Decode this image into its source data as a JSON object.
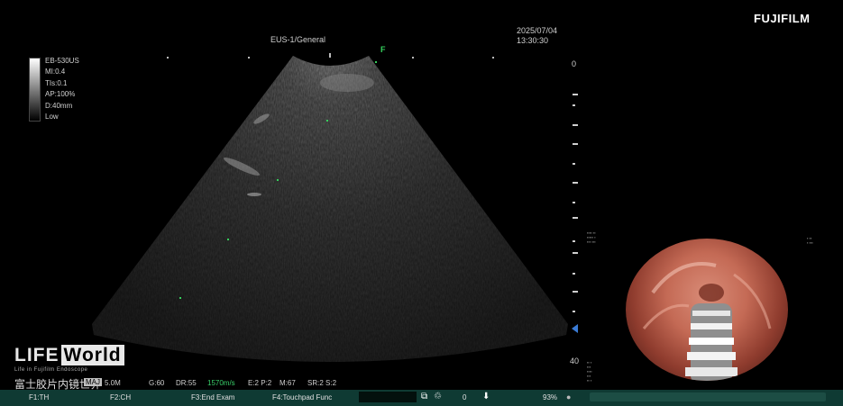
{
  "header": {
    "mode": "EUS-1/General",
    "date": "2025/07/04",
    "time": "13:30:30",
    "brand": "FUJIFILM"
  },
  "params": {
    "probe": "EB-530US",
    "mi": "MI:0.4",
    "tis": "TIs:0.1",
    "ap": "AP:100%",
    "depth": "D:40mm",
    "level": "Low"
  },
  "depth_scale": {
    "top_label": "0",
    "bottom_label": "40"
  },
  "status": {
    "freq": "MAJ",
    "focus": "5.0M",
    "gain": "G:60",
    "dr": "DR:55",
    "sound_speed": "1570m/s",
    "e2p2": "E:2 P:2",
    "m67": "M:67",
    "sr": "SR:2 S:2",
    "marker": "F"
  },
  "watermark": {
    "logo_a": "LIFE",
    "logo_b": "World",
    "sub": "Life in Fujifilm Endoscope",
    "cn": "富士胶片内镜世界"
  },
  "bottom_bar": {
    "f1": "F1:TH",
    "f2": "F2:CH",
    "f3": "F3:End Exam",
    "f4": "F4:Touchpad Func",
    "count": "0",
    "battery": "93%"
  },
  "colors": {
    "bar_bg": "#0f3a33",
    "accent_green": "#39d06a"
  }
}
